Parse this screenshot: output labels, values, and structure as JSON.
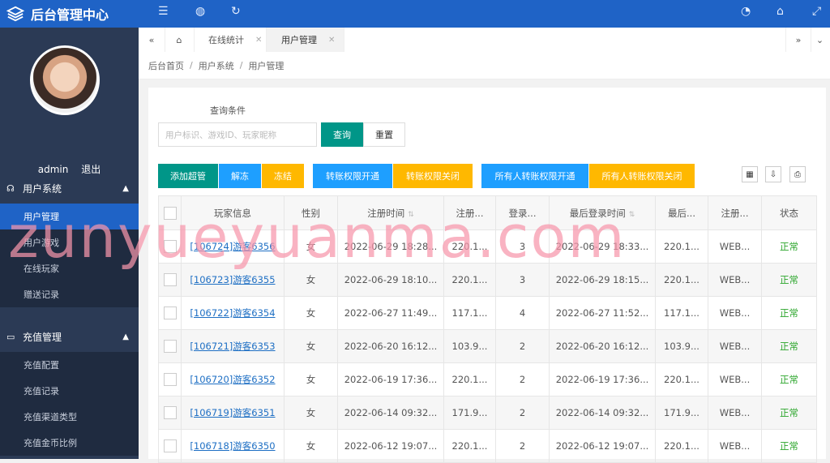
{
  "brand": {
    "title": "后台管理中心",
    "icon": "layers-icon"
  },
  "profile": {
    "username": "admin",
    "logout": "退出"
  },
  "sidebar": {
    "groups": [
      {
        "label": "用户系统",
        "icon": "user-group-icon",
        "items": [
          {
            "label": "用户管理",
            "active": true
          },
          {
            "label": "用户游戏",
            "active": false
          },
          {
            "label": "在线玩家",
            "active": false
          },
          {
            "label": "赠送记录",
            "active": false
          }
        ]
      },
      {
        "label": "充值管理",
        "icon": "card-icon",
        "items": [
          {
            "label": "充值配置"
          },
          {
            "label": "充值记录"
          },
          {
            "label": "充值渠道类型"
          },
          {
            "label": "充值金币比例"
          }
        ]
      }
    ]
  },
  "tabs": {
    "items": [
      {
        "label": "在线统计"
      },
      {
        "label": "用户管理"
      }
    ]
  },
  "breadcrumb": {
    "items": [
      "后台首页",
      "用户系统",
      "用户管理"
    ]
  },
  "query": {
    "label": "查询条件",
    "placeholder": "用户标识、游戏ID、玩家昵称",
    "search_btn": "查询",
    "reset_btn": "重置"
  },
  "actions": {
    "add_super": "添加超管",
    "unfreeze": "解冻",
    "freeze": "冻结",
    "transfer_on": "转账权限开通",
    "transfer_off": "转账权限关闭",
    "all_transfer_on": "所有人转账权限开通",
    "all_transfer_off": "所有人转账权限关闭"
  },
  "table": {
    "headers": [
      "玩家信息",
      "性别",
      "注册时间",
      "注册...",
      "登录...",
      "最后登录时间",
      "最后...",
      "注册...",
      "状态"
    ],
    "rows": [
      {
        "player": "[106724]游客6356",
        "gender": "女",
        "reg_time": "2022-06-29 18:28...",
        "reg_ip": "220.1...",
        "logins": "3",
        "last_login": "2022-06-29 18:33...",
        "last_ip": "220.1...",
        "channel": "WEB...",
        "status": "正常"
      },
      {
        "player": "[106723]游客6355",
        "gender": "女",
        "reg_time": "2022-06-29 18:10...",
        "reg_ip": "220.1...",
        "logins": "3",
        "last_login": "2022-06-29 18:15...",
        "last_ip": "220.1...",
        "channel": "WEB...",
        "status": "正常"
      },
      {
        "player": "[106722]游客6354",
        "gender": "女",
        "reg_time": "2022-06-27 11:49...",
        "reg_ip": "117.1...",
        "logins": "4",
        "last_login": "2022-06-27 11:52...",
        "last_ip": "117.1...",
        "channel": "WEB...",
        "status": "正常"
      },
      {
        "player": "[106721]游客6353",
        "gender": "女",
        "reg_time": "2022-06-20 16:12...",
        "reg_ip": "103.9...",
        "logins": "2",
        "last_login": "2022-06-20 16:12...",
        "last_ip": "103.9...",
        "channel": "WEB...",
        "status": "正常"
      },
      {
        "player": "[106720]游客6352",
        "gender": "女",
        "reg_time": "2022-06-19 17:36...",
        "reg_ip": "220.1...",
        "logins": "2",
        "last_login": "2022-06-19 17:36...",
        "last_ip": "220.1...",
        "channel": "WEB...",
        "status": "正常"
      },
      {
        "player": "[106719]游客6351",
        "gender": "女",
        "reg_time": "2022-06-14 09:32...",
        "reg_ip": "171.9...",
        "logins": "2",
        "last_login": "2022-06-14 09:32...",
        "last_ip": "171.9...",
        "channel": "WEB...",
        "status": "正常"
      },
      {
        "player": "[106718]游客6350",
        "gender": "女",
        "reg_time": "2022-06-12 19:07...",
        "reg_ip": "220.1...",
        "logins": "2",
        "last_login": "2022-06-12 19:07...",
        "last_ip": "220.1...",
        "channel": "WEB...",
        "status": "正常"
      }
    ]
  },
  "watermark": "zunyueyuanma.com",
  "colors": {
    "primary": "#1f63c6",
    "sidebar": "#2b3a55",
    "teal": "#009688",
    "blue": "#1e9fff",
    "orange": "#ffb800",
    "status_ok": "#2aa52a"
  }
}
